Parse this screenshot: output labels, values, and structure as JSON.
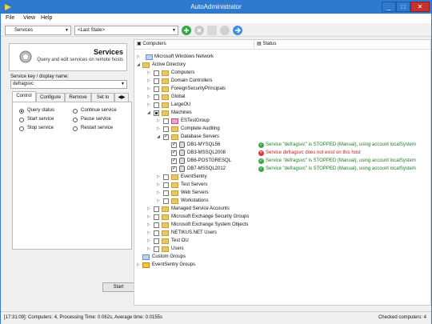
{
  "window": {
    "title": "AutoAdministrator",
    "controls": [
      "_",
      "□",
      "✕"
    ]
  },
  "menu": [
    "File",
    "View",
    "Help"
  ],
  "toolbar": {
    "module": "Services",
    "state": "<Last State>"
  },
  "left_panel": {
    "title": "Services",
    "description": "Query and edit services on remote hosts",
    "service_key_label": "Service key / display name:",
    "service_key_value": "defragsvc",
    "tabs": [
      "Control",
      "Configure",
      "Remove",
      "Set lo"
    ],
    "tab_arrows": "◀▶",
    "options": [
      {
        "label": "Query status",
        "selected": true
      },
      {
        "label": "Continue service",
        "selected": false
      },
      {
        "label": "Start service",
        "selected": false
      },
      {
        "label": "Pause service",
        "selected": false
      },
      {
        "label": "Stop service",
        "selected": false
      },
      {
        "label": "Restart service",
        "selected": false
      }
    ],
    "start_button": "Start"
  },
  "columns": {
    "computers": "Computers",
    "status": "Status"
  },
  "tree": [
    {
      "label": "Microsoft Windows Network",
      "status": ""
    },
    {
      "label": "Active Directory",
      "status": ""
    },
    {
      "label": "Computers",
      "status": ""
    },
    {
      "label": "Domain Controllers",
      "status": ""
    },
    {
      "label": "ForeignSecurityPrincipals",
      "status": ""
    },
    {
      "label": "Global",
      "status": ""
    },
    {
      "label": "LargeOU",
      "status": ""
    },
    {
      "label": "Machines",
      "status": ""
    },
    {
      "label": "ESTestGroup",
      "status": ""
    },
    {
      "label": "Complete Auditing",
      "status": ""
    },
    {
      "label": "Database Servers",
      "status": ""
    },
    {
      "label": "DB1-MYSQL56",
      "status": "Service \"defragsvc\" is STOPPED (Manual), using account localSystem"
    },
    {
      "label": "DB3-MSSQL2008",
      "status": "Service defragsvc does not exist on this host"
    },
    {
      "label": "DB6-POSTGRESQL",
      "status": "Service \"defragsvc\" is STOPPED (Manual), using account localSystem"
    },
    {
      "label": "DB7-MSSQL2012",
      "status": "Service \"defragsvc\" is STOPPED (Manual), using account localSystem"
    },
    {
      "label": "EventSentry",
      "status": ""
    },
    {
      "label": "Test Servers",
      "status": ""
    },
    {
      "label": "Web Servers",
      "status": ""
    },
    {
      "label": "Workstations",
      "status": ""
    },
    {
      "label": "Managed Service Accounts",
      "status": ""
    },
    {
      "label": "Microsoft Exchange Security Groups",
      "status": ""
    },
    {
      "label": "Microsoft Exchange System Objects",
      "status": ""
    },
    {
      "label": "NETIKUS.NET Users",
      "status": ""
    },
    {
      "label": "Test OU",
      "status": ""
    },
    {
      "label": "Users",
      "status": ""
    },
    {
      "label": "Custom Groups",
      "status": ""
    },
    {
      "label": "EventSentry Groups",
      "status": ""
    }
  ],
  "statusbar": {
    "left": "[17:31:09]: Computers: 4, Processing Time: 0.062s, Average time: 0.0155s",
    "right": "Checked computers: 4"
  },
  "colors": {
    "titlebar": "#2e7ad1",
    "ok": "#3ba84a",
    "error": "#d93333",
    "folder": "#e8c66a"
  }
}
